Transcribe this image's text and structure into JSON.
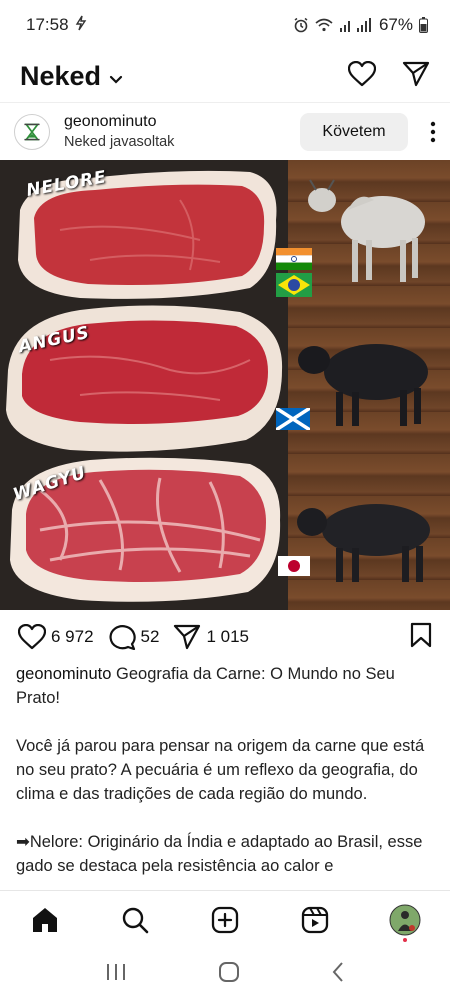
{
  "status_bar": {
    "time": "17:58",
    "battery": "67%"
  },
  "header": {
    "title": "Neked"
  },
  "post": {
    "username": "geonominuto",
    "subtitle": "Neked javasoltak",
    "follow_label": "Követem",
    "image": {
      "labels": [
        "NELORE",
        "ANGUS",
        "WAGYU"
      ]
    },
    "likes": "6 972",
    "comments": "52",
    "shares": "1 015",
    "caption": {
      "username": "geonominuto",
      "title": "Geografia da Carne: O Mundo no Seu Prato!",
      "paragraph1": "Você já parou para pensar na origem da carne que está no seu prato? A pecuária é um reflexo da geografia, do clima e das tradições de cada região do mundo.",
      "paragraph2": "➡Nelore: Originário da Índia e adaptado ao Brasil, esse gado se destaca pela resistência ao calor e"
    }
  },
  "colors": {
    "accent_red": "#e3304a",
    "follow_bg": "#efefef"
  }
}
